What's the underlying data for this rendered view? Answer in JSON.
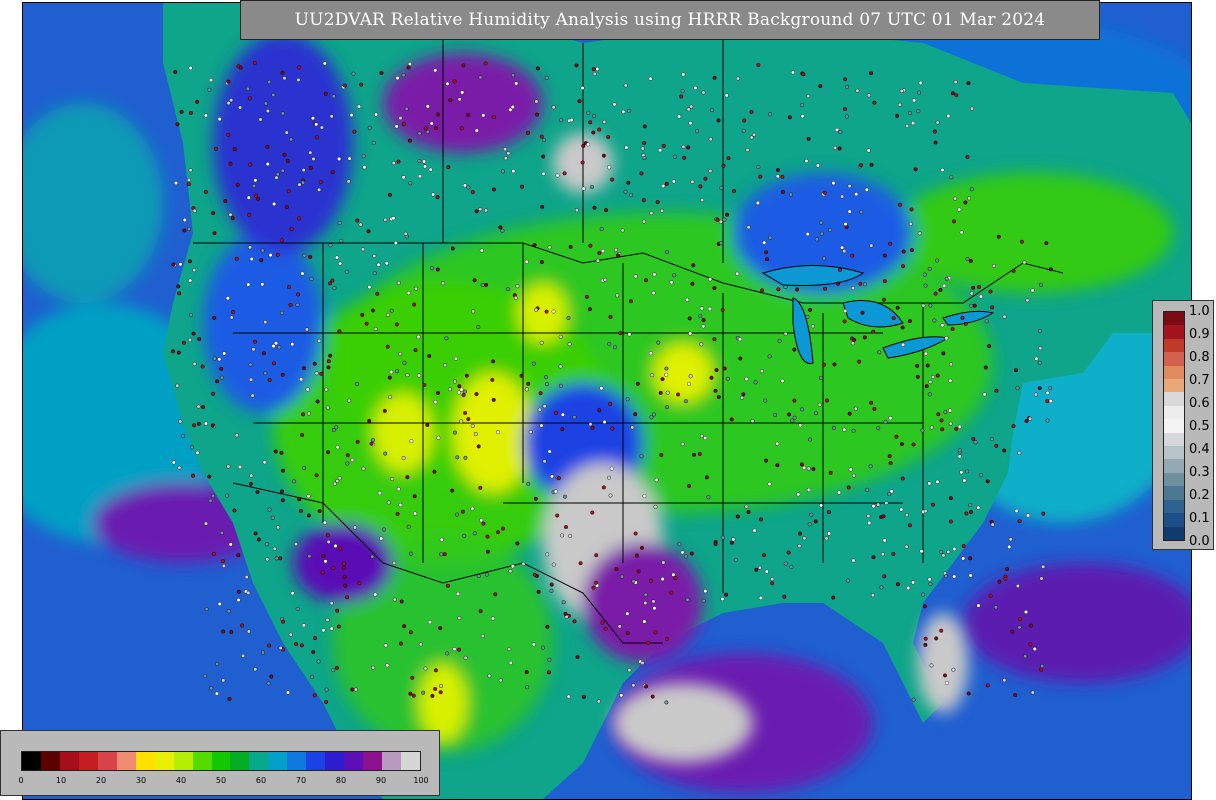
{
  "title": "UU2DVAR Relative Humidity Analysis using HRRR Background 07 UTC 01 Mar 2024",
  "obs_colorbar": {
    "ticks": [
      "1.0",
      "0.9",
      "0.8",
      "0.7",
      "0.6",
      "0.5",
      "0.4",
      "0.3",
      "0.2",
      "0.1",
      "0.0"
    ],
    "colors": [
      "#7a0a14",
      "#a3141e",
      "#c0392b",
      "#d4604e",
      "#e08a5f",
      "#e9a878",
      "#d9d9d9",
      "#ededed",
      "#f4f4f4",
      "#d4d8da",
      "#b6c3c8",
      "#93aab3",
      "#6e8f9d",
      "#4b7892",
      "#2f6291",
      "#1d4f86",
      "#123c70"
    ]
  },
  "rh_colorbar": {
    "ticks": [
      "0",
      "10",
      "20",
      "30",
      "40",
      "50",
      "60",
      "70",
      "80",
      "90",
      "100"
    ],
    "colors": [
      "#000000",
      "#5a0000",
      "#a60f1a",
      "#c41e24",
      "#d8434a",
      "#f08b73",
      "#ffe100",
      "#e8f000",
      "#b5ee00",
      "#54dc00",
      "#12c800",
      "#04ad24",
      "#06a98a",
      "#03a0c8",
      "#0c78e0",
      "#1b43e4",
      "#2f1ccf",
      "#5a10b5",
      "#8d128d",
      "#b89ac0",
      "#d6d6d6"
    ]
  },
  "map_layers": {
    "ocean_color": "#1f5fd0",
    "land_humid_color": "#0ea58a",
    "dry_color": "#33cc11",
    "very_dry_color": "#e0f000",
    "saturated_color": "#c9c9c9",
    "cloud_color": "#7a1aa8",
    "boundary_color": "#000000"
  }
}
